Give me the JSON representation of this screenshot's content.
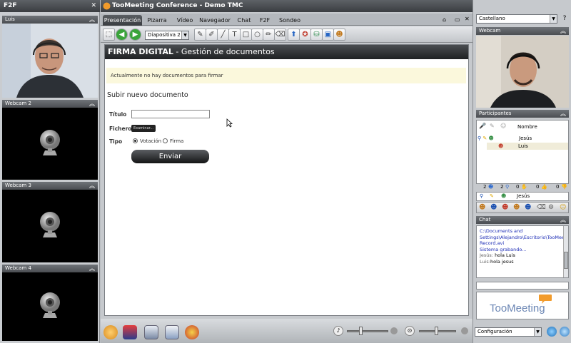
{
  "left_panel": {
    "title": "F2F",
    "close_glyph": "✕",
    "videos": [
      {
        "label": "Luis",
        "type": "live-feed"
      },
      {
        "label": "Webcam 2",
        "type": "placeholder-camera-icon"
      },
      {
        "label": "Webcam 3",
        "type": "placeholder-camera-icon"
      },
      {
        "label": "Webcam 4",
        "type": "placeholder-camera-icon"
      }
    ],
    "collapse_glyph": "︽"
  },
  "window": {
    "title": "TooMeeting Conference - Demo TMC"
  },
  "tabs": [
    "Presentación",
    "Pizarra",
    "Vídeo",
    "Navegador",
    "Chat",
    "F2F",
    "Sondeo"
  ],
  "active_tab": "Presentación",
  "toolbar": {
    "slide_select": "Diapositiva 2"
  },
  "document": {
    "header_bold": "FIRMA DIGITAL",
    "header_rest": " - Gestión de documentos",
    "notice": "Actualmente no hay documentos para firmar",
    "upload_title": "Subir nuevo documento",
    "title_label": "Título",
    "title_value": "",
    "file_label": "Fichero",
    "file_button": "Examinar...",
    "type_label": "Tipo",
    "radio_vote": "Votación",
    "radio_sign": "Firma",
    "radio_selected": "Votación",
    "send_button": "Enviar"
  },
  "right_panel": {
    "language": "Castellano",
    "help": "?",
    "webcam_title": "Webcam",
    "participants_title": "Participantes",
    "name_header": "Nombre",
    "participants": [
      "Jesús",
      "Luis"
    ],
    "stats": [
      "2",
      "2",
      "0",
      "0",
      "0"
    ],
    "current_user": "Jesús",
    "chat_title": "Chat",
    "chat_lines": [
      {
        "text": "C:\\Documents and Settings\\Alejandro\\Escritorio\\TooMeeting Record.avi",
        "color": "#1b2bb5"
      },
      {
        "text": "Sistema grabando...",
        "color": "#1b2bb5"
      },
      {
        "who": "Jesús:",
        "text": " hola Luis"
      },
      {
        "who": "Luis:",
        "text": "hola jesus"
      }
    ],
    "logo_text": "TooMeeting",
    "config_select": "Configuración"
  },
  "colors": {
    "accent_dark": "#3a3d41",
    "notice_bg": "#fbf8dc",
    "chat_system": "#1b2bb5"
  }
}
